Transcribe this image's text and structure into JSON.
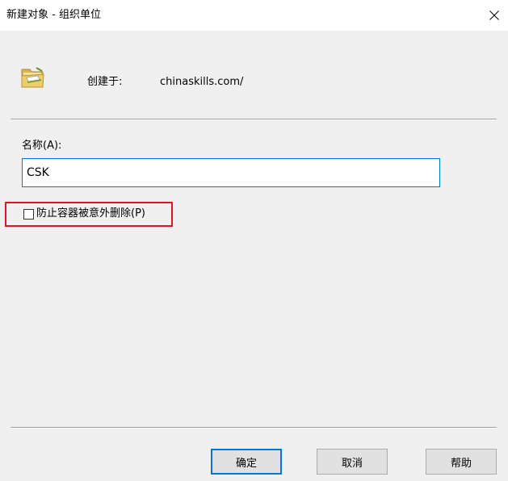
{
  "window": {
    "title": "新建对象 - 组织单位"
  },
  "header": {
    "icon": "organizational-unit-folder-icon",
    "created_label": "创建于:",
    "created_value": "chinaskills.com/"
  },
  "form": {
    "name_label": "名称(A):",
    "name_value": "CSK",
    "protect_label": "防止容器被意外删除(P)",
    "protect_checked": false
  },
  "buttons": {
    "ok": "确定",
    "cancel": "取消",
    "help": "帮助"
  },
  "colors": {
    "accent": "#0078d7",
    "highlight": "#e81123",
    "dialog_background": "#f0f0f0"
  }
}
